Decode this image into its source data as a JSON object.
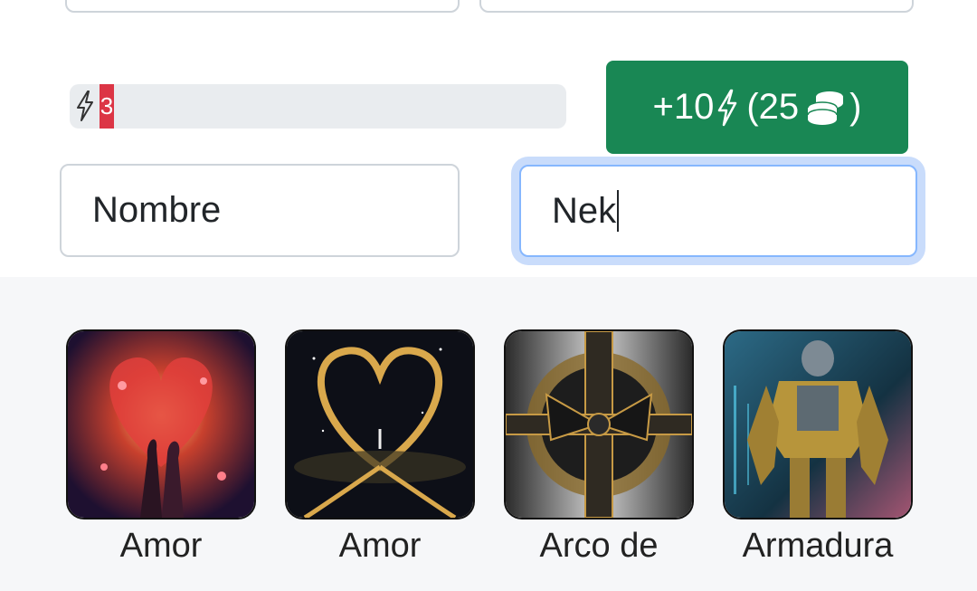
{
  "energy": {
    "count": "3",
    "level": 0.03
  },
  "buy_button": {
    "prefix": "+10",
    "middle": "(25",
    "suffix": ")"
  },
  "form": {
    "name_placeholder": "Nombre",
    "nick_value": "Nek"
  },
  "gallery": {
    "items": [
      {
        "label": "Amor",
        "icon": "two-women-heart-image"
      },
      {
        "label": "Amor",
        "icon": "cosmic-heart-image"
      },
      {
        "label": "Arco de",
        "icon": "ribbon-bow-image"
      },
      {
        "label": "Armadura",
        "icon": "robot-armor-image"
      }
    ]
  },
  "colors": {
    "accent_green": "#198754",
    "energy_red": "#dc3545",
    "focus_blue": "#86b7fe"
  }
}
